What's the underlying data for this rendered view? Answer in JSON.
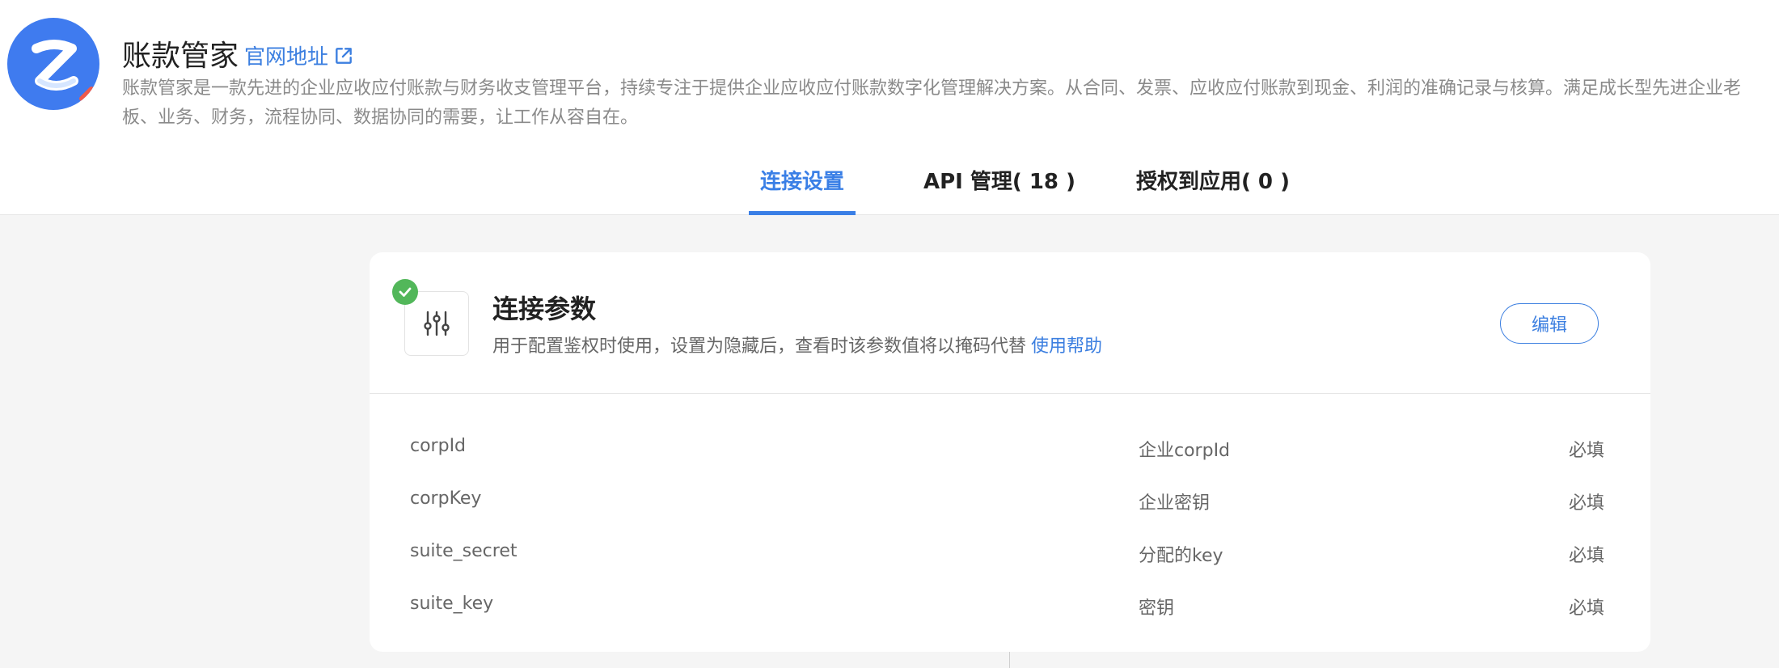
{
  "app": {
    "title": "账款管家",
    "site_link": "官网地址",
    "description": "账款管家是一款先进的企业应收应付账款与财务收支管理平台，持续专注于提供企业应收应付账款数字化管理解决方案。从合同、发票、应收应付账款到现金、利润的准确记录与核算。满足成长型先进企业老板、业务、财务，流程协同、数据协同的需要，让工作从容自在。",
    "logo_icon": "z-logo-icon",
    "brand_color": "#3f7bef"
  },
  "tabs": [
    {
      "label": "连接设置",
      "active": true
    },
    {
      "label": "API 管理( 18 )",
      "active": false
    },
    {
      "label": "授权到应用( 0 )",
      "active": false
    }
  ],
  "card": {
    "title": "连接参数",
    "subtitle": "用于配置鉴权时使用，设置为隐藏后，查看时该参数值将以掩码代替",
    "help_link": "使用帮助",
    "edit_label": "编辑",
    "icon": "sliders-icon",
    "status_icon": "check-icon",
    "status_color": "#52b75a",
    "accent_color": "#3c7fe0"
  },
  "params": [
    {
      "name": "corpId",
      "desc": "企业corpId",
      "required": "必填"
    },
    {
      "name": "corpKey",
      "desc": "企业密钥",
      "required": "必填"
    },
    {
      "name": "suite_secret",
      "desc": "分配的key",
      "required": "必填"
    },
    {
      "name": "suite_key",
      "desc": "密钥",
      "required": "必填"
    }
  ]
}
